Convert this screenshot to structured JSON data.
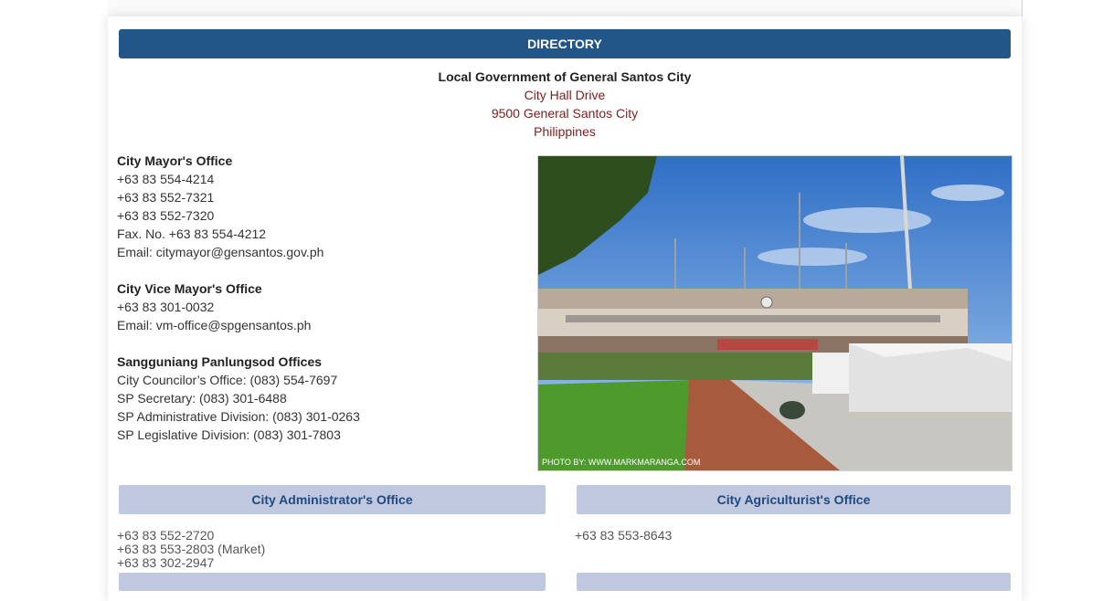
{
  "directory_title": "DIRECTORY",
  "header": {
    "title": "Local Government of General Santos City",
    "address": [
      "City Hall Drive",
      "9500 General Santos City",
      "Philippines"
    ]
  },
  "mayor": {
    "title": "City Mayor's Office",
    "lines": [
      "+63 83 554-4214",
      "+63 83 552-7321",
      "+63 83 552-7320",
      "Fax. No. +63 83 554-4212",
      "Email: citymayor@gensantos.gov.ph"
    ]
  },
  "vice_mayor": {
    "title": "City Vice Mayor's Office",
    "lines": [
      "+63 83 301-0032",
      "Email: vm-office@spgensantos.ph"
    ]
  },
  "sp": {
    "title": "Sangguniang Panlungsod Offices",
    "lines": [
      "City Councilor’s Office: (083) 554-7697",
      "SP Secretary: (083) 301-6488",
      "SP Administrative Division: (083) 301-0263",
      "SP Legislative Division: (083) 301-7803"
    ]
  },
  "photo": {
    "credit": "PHOTO BY: WWW.MARKMARANGA.COM"
  },
  "admin": {
    "title": "City Administrator's Office",
    "lines": [
      "+63 83 552-2720",
      "+63 83 553-2803 (Market)",
      "+63 83 302-2947"
    ]
  },
  "agri": {
    "title": "City Agriculturist's Office",
    "lines": [
      "+63 83 553-8643"
    ]
  },
  "colors": {
    "header_bar": "#225588",
    "sub_bar": "#bfc8df",
    "address": "#7a1e1e"
  }
}
